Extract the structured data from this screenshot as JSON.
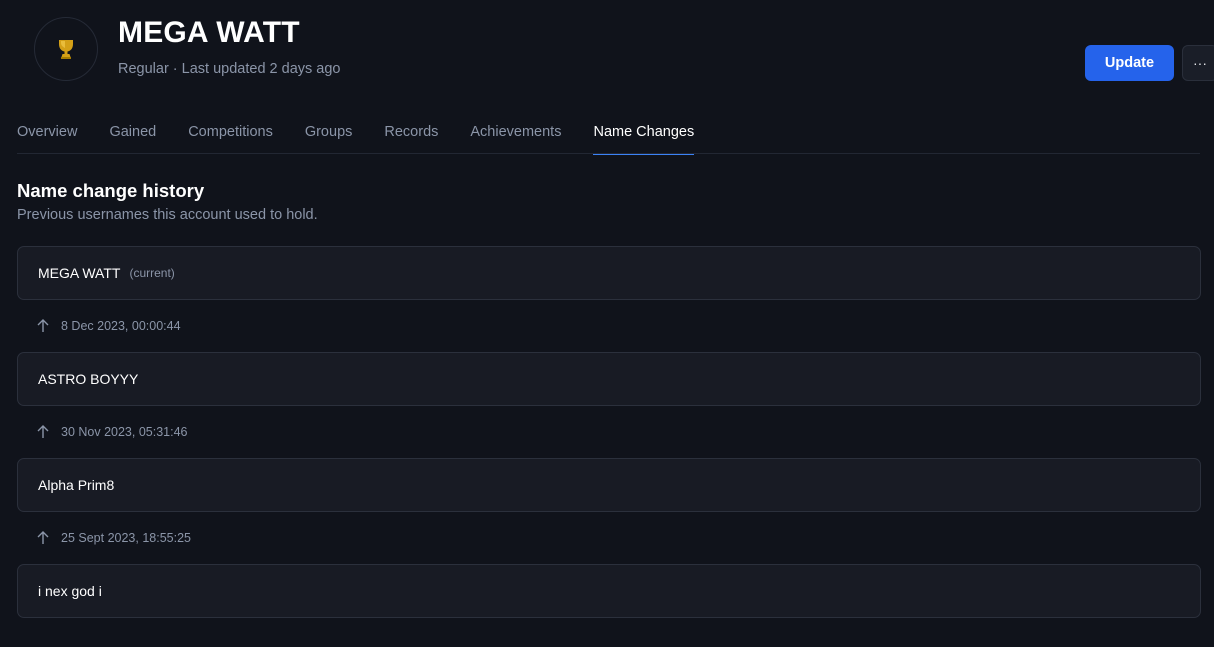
{
  "header": {
    "avatar_icon": "trophy-icon",
    "title": "MEGA WATT",
    "subtitle": "Regular · Last updated 2 days ago",
    "update_label": "Update",
    "more_label": "···"
  },
  "tabs": [
    {
      "label": "Overview",
      "active": false
    },
    {
      "label": "Gained",
      "active": false
    },
    {
      "label": "Competitions",
      "active": false
    },
    {
      "label": "Groups",
      "active": false
    },
    {
      "label": "Records",
      "active": false
    },
    {
      "label": "Achievements",
      "active": false
    },
    {
      "label": "Name Changes",
      "active": true
    }
  ],
  "section": {
    "title": "Name change history",
    "description": "Previous usernames this account used to hold."
  },
  "history": {
    "current_tag": "(current)",
    "names": [
      {
        "name": "MEGA WATT",
        "current": true
      },
      {
        "name": "ASTRO BOYYY",
        "current": false
      },
      {
        "name": "Alpha Prim8",
        "current": false
      },
      {
        "name": "i nex god i",
        "current": false
      }
    ],
    "changes": [
      {
        "icon": "arrow-up-icon",
        "date": "8 Dec 2023, 00:00:44"
      },
      {
        "icon": "arrow-up-icon",
        "date": "30 Nov 2023, 05:31:46"
      },
      {
        "icon": "arrow-up-icon",
        "date": "25 Sept 2023, 18:55:25"
      }
    ]
  },
  "colors": {
    "background": "#10131b",
    "card": "#181b24",
    "accent": "#2563eb",
    "tab_indicator": "#3b82f6",
    "muted_text": "#8b95a8"
  }
}
